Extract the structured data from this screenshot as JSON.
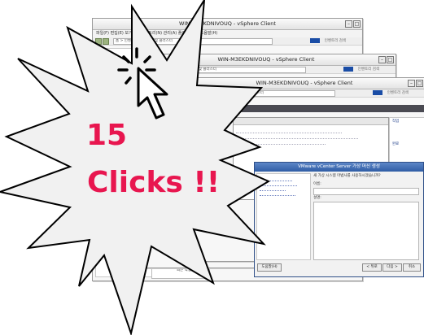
{
  "windows": [
    {
      "title": "WIN-M3EKDNIVOUQ - vSphere Client",
      "menu": "파일(F) 편집(E) 보기(W) 인벤토리(N) 관리(A) 플러그인(P) 도움말(H)",
      "address": "홈 > 인벤토리 > 호스트 및 클러스터",
      "search": "인벤토리 검색"
    },
    {
      "title": "WIN-M3EKDNIVOUQ - vSphere Client",
      "address": "홈 > 인벤토리 > 호스트 및 클러스터",
      "search": "인벤토리 검색"
    },
    {
      "title": "WIN-M3EKDNIVOUQ - vSphere Client",
      "address": "홈 > 인벤토리 > 호스트 및 클러스터",
      "search": "인벤토리 검색"
    }
  ],
  "dialog": {
    "title": "VMware vCenter Server 가상 머신 생성",
    "question": "새 가상 시스템 마법사를 사용하시겠습니까?",
    "name_label": "이름:",
    "description_label": "설명:",
    "help_button": "도움말(H)",
    "back_button": "< 뒤로",
    "next_button": "다음 >",
    "cancel_button": "취소"
  },
  "side_panel": {
    "label": "작업",
    "status": "완료"
  },
  "bottom_tab": "최근 작업",
  "starburst": {
    "count_line": "15",
    "word_line": "Clicks !!",
    "text_color": "#e8164f",
    "fill_color": "#f1f1f1"
  }
}
